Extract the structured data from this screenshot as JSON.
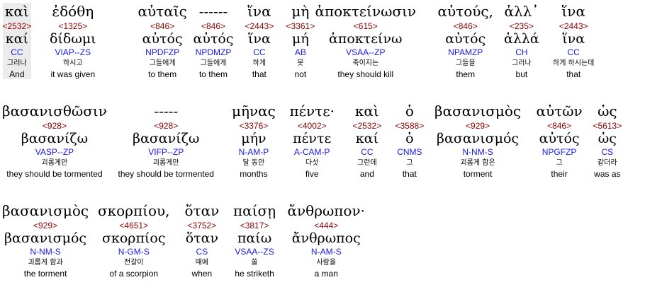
{
  "rows": [
    [
      {
        "greek": "καὶ",
        "strong": "<2532>",
        "lemma": "καί",
        "morph": "CC",
        "korean": "그러나",
        "english": "And"
      },
      {
        "greek": "ἐδόθη",
        "strong": "<1325>",
        "lemma": "δίδωμι",
        "morph": "VIAP--ZS",
        "korean": "하시고",
        "english": "it was given"
      },
      {
        "greek": "αὐταῖς",
        "strong": "<846>",
        "lemma": "αὐτός",
        "morph": "NPDFZP",
        "korean": "그들에게",
        "english": "to them"
      },
      {
        "greek": "------",
        "strong": "<846>",
        "lemma": "αὐτός",
        "morph": "NPDMZP",
        "korean": "그들에게",
        "english": "to them"
      },
      {
        "greek": "ἵνα",
        "strong": "<2443>",
        "lemma": "ἵνα",
        "morph": "CC",
        "korean": "하게",
        "english": "that"
      },
      {
        "greek": "μὴ",
        "strong": "<3361>",
        "lemma": "μή",
        "morph": "AB",
        "korean": "못",
        "english": "not"
      },
      {
        "greek": "ἀποκτείνωσιν",
        "strong": "<615>",
        "lemma": "ἀποκτείνω",
        "morph": "VSAA--ZP",
        "korean": "죽이지는",
        "english": "they should kill"
      },
      {
        "greek": "αὐτούς,",
        "strong": "<846>",
        "lemma": "αὐτός",
        "morph": "NPAMZP",
        "korean": "그들을",
        "english": "them"
      },
      {
        "greek": "ἀλλ᾽",
        "strong": "<235>",
        "lemma": "ἀλλά",
        "morph": "CH",
        "korean": "그러나",
        "english": "but"
      },
      {
        "greek": "ἵνα",
        "strong": "<2443>",
        "lemma": "ἵνα",
        "morph": "CC",
        "korean": "하게 하시는데",
        "english": "that"
      }
    ],
    [
      {
        "greek": "βασανισθῶσιν",
        "strong": "<928>",
        "lemma": "βασανίζω",
        "morph": "VASP--ZP",
        "korean": "괴롭게만",
        "english": "they should be tormented"
      },
      {
        "greek": "-----",
        "strong": "<928>",
        "lemma": "βασανίζω",
        "morph": "VIFP--ZP",
        "korean": "괴롭게만",
        "english": "they should be tormented"
      },
      {
        "greek": "μῆνας",
        "strong": "<3376>",
        "lemma": "μήν",
        "morph": "N-AM-P",
        "korean": "달 동안",
        "english": "months"
      },
      {
        "greek": "πέντε·",
        "strong": "<4002>",
        "lemma": "πέντε",
        "morph": "A-CAM-P",
        "korean": "다섯",
        "english": "five"
      },
      {
        "greek": "καὶ",
        "strong": "<2532>",
        "lemma": "καί",
        "morph": "CC",
        "korean": "그런데",
        "english": "and"
      },
      {
        "greek": "ὁ",
        "strong": "<3588>",
        "lemma": "ὁ",
        "morph": "CNMS",
        "korean": "그",
        "english": "that"
      },
      {
        "greek": "βασανισμὸς",
        "strong": "<929>",
        "lemma": "βασανισμός",
        "morph": "N-NM-S",
        "korean": "괴롭게 함은",
        "english": "torment"
      },
      {
        "greek": "αὐτῶν",
        "strong": "<846>",
        "lemma": "αὐτός",
        "morph": "NPGFZP",
        "korean": "그",
        "english": "their"
      },
      {
        "greek": "ὡς",
        "strong": "<5613>",
        "lemma": "ὡς",
        "morph": "CS",
        "korean": "같더라",
        "english": "was as"
      }
    ],
    [
      {
        "greek": "βασανισμὸς",
        "strong": "<929>",
        "lemma": "βασανισμός",
        "morph": "N-NM-S",
        "korean": "괴롭게 함과",
        "english": "the torment"
      },
      {
        "greek": "σκορπίου,",
        "strong": "<4651>",
        "lemma": "σκορπίος",
        "morph": "N-GM-S",
        "korean": "전갈이",
        "english": "of a scorpion"
      },
      {
        "greek": "ὅταν",
        "strong": "<3752>",
        "lemma": "ὅταν",
        "morph": "CS",
        "korean": "때에",
        "english": "when"
      },
      {
        "greek": "παίσῃ",
        "strong": "<3817>",
        "lemma": "παίω",
        "morph": "VSAA--ZS",
        "korean": "쏠",
        "english": "he striketh"
      },
      {
        "greek": "ἄνθρωπον·",
        "strong": "<444>",
        "lemma": "ἄνθρωπος",
        "morph": "N-AM-S",
        "korean": "사람을",
        "english": "a man"
      }
    ]
  ],
  "colors": {
    "strong": "#8b0000",
    "morph": "#1a1ae6",
    "text": "#000000"
  }
}
